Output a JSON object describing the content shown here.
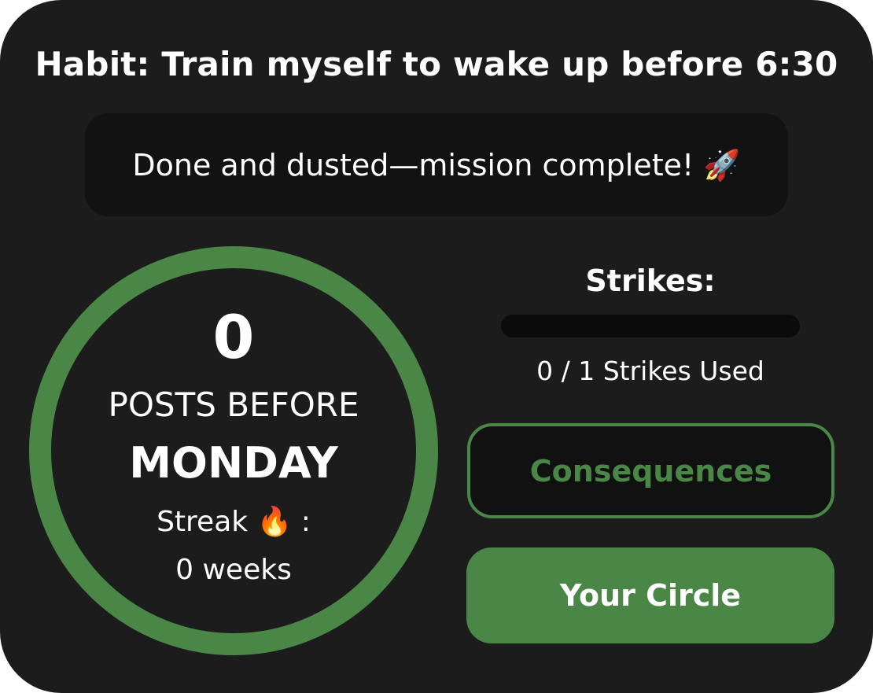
{
  "habit_title": "Habit: Train myself to wake up before 6:30",
  "status_message": "Done and dusted—mission complete! 🚀",
  "countdown": {
    "count": "0",
    "label": "POSTS BEFORE",
    "day": "MONDAY",
    "streak_label": "Streak 🔥 :",
    "streak_value": "0 weeks"
  },
  "progress_ring_fraction": 1.0,
  "strikes": {
    "title": "Strikes:",
    "used": 0,
    "total": 1,
    "fill_fraction": 0.0,
    "used_text": "0 / 1 Strikes Used"
  },
  "buttons": {
    "consequences_label": "Consequences",
    "circle_label": "Your Circle"
  },
  "colors": {
    "accent_green": "#4a8746",
    "card_background": "#1c1c1c",
    "panel_background": "#121212",
    "strike_track": "#0b0b0b",
    "text": "#ffffff"
  }
}
